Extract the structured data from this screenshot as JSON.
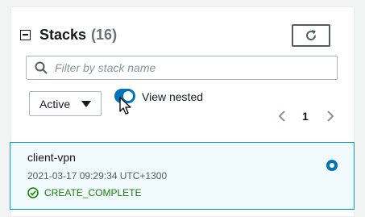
{
  "header": {
    "title": "Stacks",
    "count": "(16)"
  },
  "toolbar": {
    "refresh_icon": "refresh-icon"
  },
  "search": {
    "placeholder": "Filter by stack name",
    "value": ""
  },
  "filter": {
    "status_value": "Active"
  },
  "nested_toggle": {
    "label": "View nested",
    "on": true
  },
  "pagination": {
    "current_page": "1"
  },
  "stacks": [
    {
      "name": "client-vpn",
      "created": "2021-03-17 09:29:34 UTC+1300",
      "status": "CREATE_COMPLETE",
      "selected": true
    }
  ],
  "colors": {
    "accent": "#0073bb",
    "success": "#1d8102",
    "selected_bg": "#f1faff",
    "selected_border": "#00a1c9"
  }
}
